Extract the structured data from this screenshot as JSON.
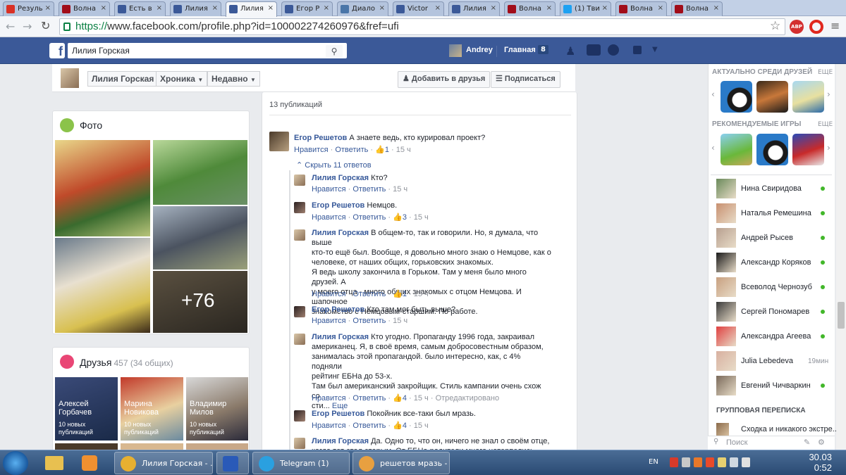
{
  "browser": {
    "tabs": [
      {
        "label": "Резуль",
        "icon": "gmail-icon",
        "color": "#d93025"
      },
      {
        "label": "Волна",
        "icon": "wave-icon",
        "color": "#a10d1a"
      },
      {
        "label": "Есть в",
        "icon": "facebook-icon",
        "color": "#3b5998"
      },
      {
        "label": "Лилия",
        "icon": "facebook-icon",
        "color": "#3b5998"
      },
      {
        "label": "Лилия",
        "icon": "facebook-icon",
        "color": "#3b5998",
        "active": true
      },
      {
        "label": "Егор Р",
        "icon": "facebook-icon",
        "color": "#3b5998"
      },
      {
        "label": "Диало",
        "icon": "dialog-icon",
        "color": "#4a76a8"
      },
      {
        "label": "Victor",
        "icon": "facebook-icon",
        "color": "#3b5998"
      },
      {
        "label": "Лилия",
        "icon": "facebook-icon",
        "color": "#3b5998"
      },
      {
        "label": "Волна",
        "icon": "wave-icon",
        "color": "#a10d1a"
      },
      {
        "label": "(1) Тви",
        "icon": "twitter-icon",
        "color": "#1da1f2"
      },
      {
        "label": "Волна",
        "icon": "wave-icon",
        "color": "#a10d1a"
      },
      {
        "label": "Волна",
        "icon": "wave-icon",
        "color": "#a10d1a"
      }
    ],
    "url_prefix": "https://",
    "url_rest": "www.facebook.com/profile.php?id=100002274260976&fref=ufi",
    "abp_label": "ABP"
  },
  "fb": {
    "search_value": "Лилия Горская",
    "user": "Andrey",
    "home": "Главная",
    "home_count": "8"
  },
  "profile": {
    "name": "Лилия Горская",
    "timeline": "Хроника",
    "recent": "Недавно",
    "add_friend": "Добавить в друзья",
    "follow": "Подписаться"
  },
  "photos": {
    "title": "Фото",
    "more": "+76"
  },
  "friends": {
    "title": "Друзья",
    "count": "457 (34 общих)",
    "items": [
      {
        "first": "Алексей",
        "last": "Горбачев",
        "l1": "10 новых",
        "l2": "публикаций"
      },
      {
        "first": "Марина",
        "last": "Новикова",
        "l1": "10 новых",
        "l2": "публикаций"
      },
      {
        "first": "Владимир",
        "last": "Милов",
        "l1": "10 новых",
        "l2": "публикаций"
      }
    ]
  },
  "post": {
    "count": "13 публикаций",
    "like": "Нравится",
    "reply": "Ответить",
    "hide_replies": "Скрыть 11 ответов",
    "top": {
      "author": "Егор Решетов",
      "text": "А знаете ведь, кто курировал проект?",
      "likes": "1",
      "time": "15 ч"
    },
    "replies": [
      {
        "author": "Лилия Горская",
        "lines": [
          "Кто?"
        ],
        "likes": "",
        "time": "15 ч"
      },
      {
        "author": "Егор Решетов",
        "lines": [
          "Немцов."
        ],
        "likes": "3",
        "time": "15 ч"
      },
      {
        "author": "Лилия Горская",
        "lines": [
          "В общем-то, так и говорили. Но, я думала, что выше",
          "кто-то ещё был. Вообще, я довольно много знаю о Немцове, как о",
          "человеке, от наших общих, горьковских знакомых.",
          "Я ведь школу закончила в Горьком. Там у меня было много друзей. А",
          "у моего отца - много общих знакомых с отцом Немцова. И шапочное",
          "знакомство с Немцовым-старшим. По работе."
        ],
        "likes": "1",
        "time": "15 ч"
      },
      {
        "author": "Егор Решетов",
        "lines": [
          "Кто там мог быть выше?"
        ],
        "likes": "",
        "time": "15 ч"
      },
      {
        "author": "Лилия Горская",
        "lines": [
          "Кто угодно. Пропаганду 1996 года, закраивал",
          "американец. Я, в своё время, самым добросовестным образом,",
          "занималась этой пропагандой. было интересно, как, с 4% подняли",
          "рейтинг ЕБНа до 53-х.",
          "Там был американский закройщик. Стиль кампании очень схож со",
          "сти..."
        ],
        "more": "Еще",
        "likes": "4",
        "time": "15 ч",
        "edited": "Отредактировано"
      },
      {
        "author": "Егор Решетов",
        "lines": [
          "Покойник все-таки был мразь."
        ],
        "likes": "4",
        "time": "15 ч"
      },
      {
        "author": "Лилия Горская",
        "lines": [
          "Да. Одно то, что он, ничего не знал о своём отце,",
          "когда тот стал старым. От ЕБНа родители много натерпелись.",
          "Начиная с уголовного дела с парнухой и мошенничеством."
        ],
        "likes": "",
        "time": ""
      }
    ]
  },
  "sidebar": {
    "trending_title": "АКТУАЛЬНО СРЕДИ ДРУЗЕЙ",
    "more": "ЕЩЕ",
    "games_title": "РЕКОМЕНДУЕМЫЕ ИГРЫ",
    "group_title": "ГРУППОВАЯ ПЕРЕПИСКА",
    "group_item": "Сходка и никакого экстре...",
    "search_placeholder": "Поиск",
    "contacts": [
      {
        "name": "Нина Свиридова",
        "online": true
      },
      {
        "name": "Наталья Ремешина",
        "online": true
      },
      {
        "name": "Андрей Рысев",
        "online": true
      },
      {
        "name": "Александр Коряков",
        "online": true
      },
      {
        "name": "Всеволод Чернозуб",
        "online": true
      },
      {
        "name": "Сергей Пономарев",
        "online": true
      },
      {
        "name": "Александра Агеева",
        "online": true
      },
      {
        "name": "Julia Lebedeva",
        "online": false,
        "time": "19мин"
      },
      {
        "name": "Евгений Чичваркин",
        "online": true
      }
    ]
  },
  "taskbar": {
    "items": [
      {
        "label": "Лилия Горская - ...",
        "icon": "chrome-icon"
      },
      {
        "label": "",
        "icon": "word-icon"
      },
      {
        "label": "Telegram (1)",
        "icon": "telegram-icon"
      },
      {
        "label": "решетов мразь - ...",
        "icon": "paint-icon"
      }
    ],
    "lang": "EN",
    "clock_date": "30.03",
    "clock_time": "0:52"
  }
}
